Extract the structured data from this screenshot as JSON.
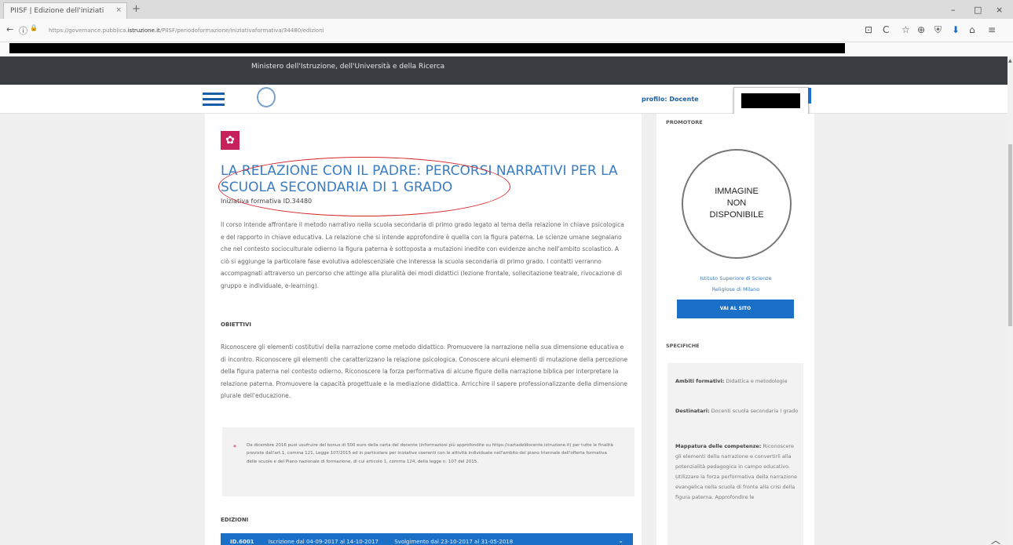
{
  "browser": {
    "tab_title": "PIISF | Edizione dell'iniziati",
    "tab_close": "×",
    "new_tab": "+",
    "window_controls": [
      "–",
      "□",
      "×"
    ],
    "back_icon": "←",
    "info_icon": "ⓘ",
    "lock_icon": "🔒",
    "url_prefix": "https://governance.pubblica.",
    "url_domain": "istruzione.it",
    "url_suffix": "/PIISF/periodoformazione/iniziativaformativa/34480/edizioni",
    "toolbar_icons": [
      "⊡",
      "C",
      "☆",
      "⊕",
      "⛨",
      "⬇",
      "⌂",
      "≡"
    ]
  },
  "header": {
    "ministry": "Ministero dell'Istruzione, dell'Università e della Ricerca",
    "profile_label": "profilo: Docente"
  },
  "course": {
    "category_icon": "✿",
    "title": "LA RELAZIONE CON IL PADRE: PERCORSI NARRATIVI PER LA SCUOLA SECONDARIA DI 1 GRADO",
    "subtitle": "Iniziativa formativa ID.34480",
    "description": "Il corso intende affrontare il metodo narrativo nella scuola secondaria di primo grado legato al tema della relazione in chiave psicologica e del rapporto in chiave educativa. La relazione che si intende approfondire è quella con la figura paterna. Le scienze umane segnalano che nel contesto socioculturale odierno la figura paterna è sottoposta a mutazioni inedite con evidenze anche nell'ambito scolastico. A ciò si aggiunge la particolare fase evolutiva adolescenziale che interessa la scuola secondaria di primo grado. I contatti verranno accompagnati attraverso un percorso che attinge alla pluralità dei modi didattici (lezione frontale, sollecitazione teatrale, rivocazione di gruppo e individuale, e-learning).",
    "objectives_heading": "OBIETTIVI",
    "objectives": "Riconoscere gli elementi costitutivi della narrazione come metodo didattico. Promuovere la narrazione nella sua dimensione educativa e di incontro. Riconoscere gli elementi che caratterizzano la relazione psicologica. Conoscere alcuni elementi di mutazione della percezione della figura paterna nel contesto odierno. Riconoscere la forza performativa di alcune figure della narrazione biblica per interpretare la relazione paterna. Promuovere la capacità progettuale e la mediazione didattica. Arricchire il sapere professionalizzante della dimensione plurale dell'educazione.",
    "note_star": "*",
    "note": "Da dicembre 2016 puoi usufruire del bonus di 500 euro della carta del docente (informazioni più approfondite su https://cartadeldocente.istruzione.it) per tutte le finalità previste dall'art.1, comma 121, Legge 107/2015 ed in particolare per iniziative coerenti con le attività individuate nell'ambito del piano triennale dell'offerta formativa delle scuole e del Piano nazionale di formazione, di cui articolo 1, comma 124, della legge n. 107 del 2015.",
    "editions_heading": "EDIZIONI",
    "edition_id": "ID.6001",
    "edition_enroll": "Iscrizione dal 04-09-2017 al 14-10-2017",
    "edition_run": "Svolgimento dal 23-10-2017 al 31-05-2018",
    "edition_chevron": "⌄"
  },
  "sidebar": {
    "promoter_heading": "PROMOTORE",
    "image_placeholder_1": "IMMAGINE",
    "image_placeholder_2": "NON",
    "image_placeholder_3": "DISPONIBILE",
    "promoter_name_1": "Istituto Superiore di Scienze",
    "promoter_name_2": "Religiose di Milano",
    "site_button": "VAI AL SITO",
    "specs_heading": "SPECIFICHE",
    "specs": [
      {
        "label": "Ambiti formativi:",
        "value": "Didattica e metodologie"
      },
      {
        "label": "Destinatari:",
        "value": "Docenti scuola secondaria I grado"
      },
      {
        "label": "Mappatura delle competenze:",
        "value": "Riconoscere gli elementi della narrazione e convertirli alla potenzialità pedagogica in campo educativo. Utilizzare la forza performativa della narrazione evangelica nella scuola di fronte alla crisi della figura paterna. Approfondire le"
      }
    ]
  },
  "scroll_top_icon": "︿"
}
